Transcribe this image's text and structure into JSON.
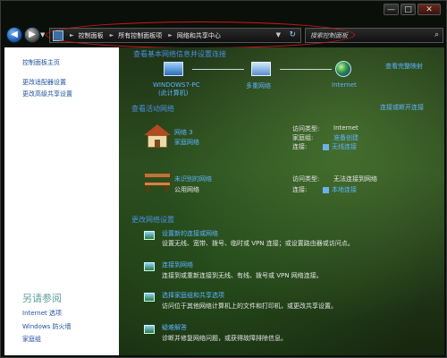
{
  "window": {
    "caption": {
      "minimize": "—",
      "maximize": "□",
      "close": "✕"
    }
  },
  "address": {
    "crumbs": [
      "控制面板",
      "所有控制面板项",
      "网络和共享中心"
    ],
    "search_placeholder": "搜索控制面板"
  },
  "left": {
    "links": [
      "控制面板主页",
      "更改适配器设置",
      "更改高级共享设置"
    ],
    "see_also_title": "另请参阅",
    "see_also": [
      "Internet 选项",
      "Windows 防火墙",
      "家庭组"
    ]
  },
  "map": {
    "title": "查看基本网络信息并设置连接",
    "full_map": "查看完整映射",
    "nodes": [
      {
        "label": "WINDOWS7-PC",
        "sub": "(此计算机)",
        "icon": "pc-icon"
      },
      {
        "label": "多重网络",
        "icon": "network-icon"
      },
      {
        "label": "Internet",
        "icon": "globe-icon"
      }
    ]
  },
  "active": {
    "title": "查看活动网络",
    "connect_link": "连接或断开连接",
    "networks": [
      {
        "name": "网络 3",
        "type": "家庭网络",
        "access_label": "访问类型:",
        "access": "Internet",
        "homegroup_label": "家庭组:",
        "homegroup": "准备创建",
        "conn_label": "连接:",
        "conn": "无线连接"
      },
      {
        "name": "未识别的网络",
        "type": "公用网络",
        "access_label": "访问类型:",
        "access": "无法连接到网络",
        "conn_label": "连接:",
        "conn": "本地连接"
      }
    ]
  },
  "change": {
    "title": "更改网络设置",
    "items": [
      {
        "title": "设置新的连接或网络",
        "desc": "设置无线、宽带、拨号、临时或 VPN 连接；或设置路由器或访问点。"
      },
      {
        "title": "连接到网络",
        "desc": "连接到或重新连接到无线、有线、拨号或 VPN 网络连接。"
      },
      {
        "title": "选择家庭组和共享选项",
        "desc": "访问位于其他网络计算机上的文件和打印机，或更改共享设置。"
      },
      {
        "title": "疑难解答",
        "desc": "诊断并修复网络问题，或获得故障排除信息。"
      }
    ]
  }
}
